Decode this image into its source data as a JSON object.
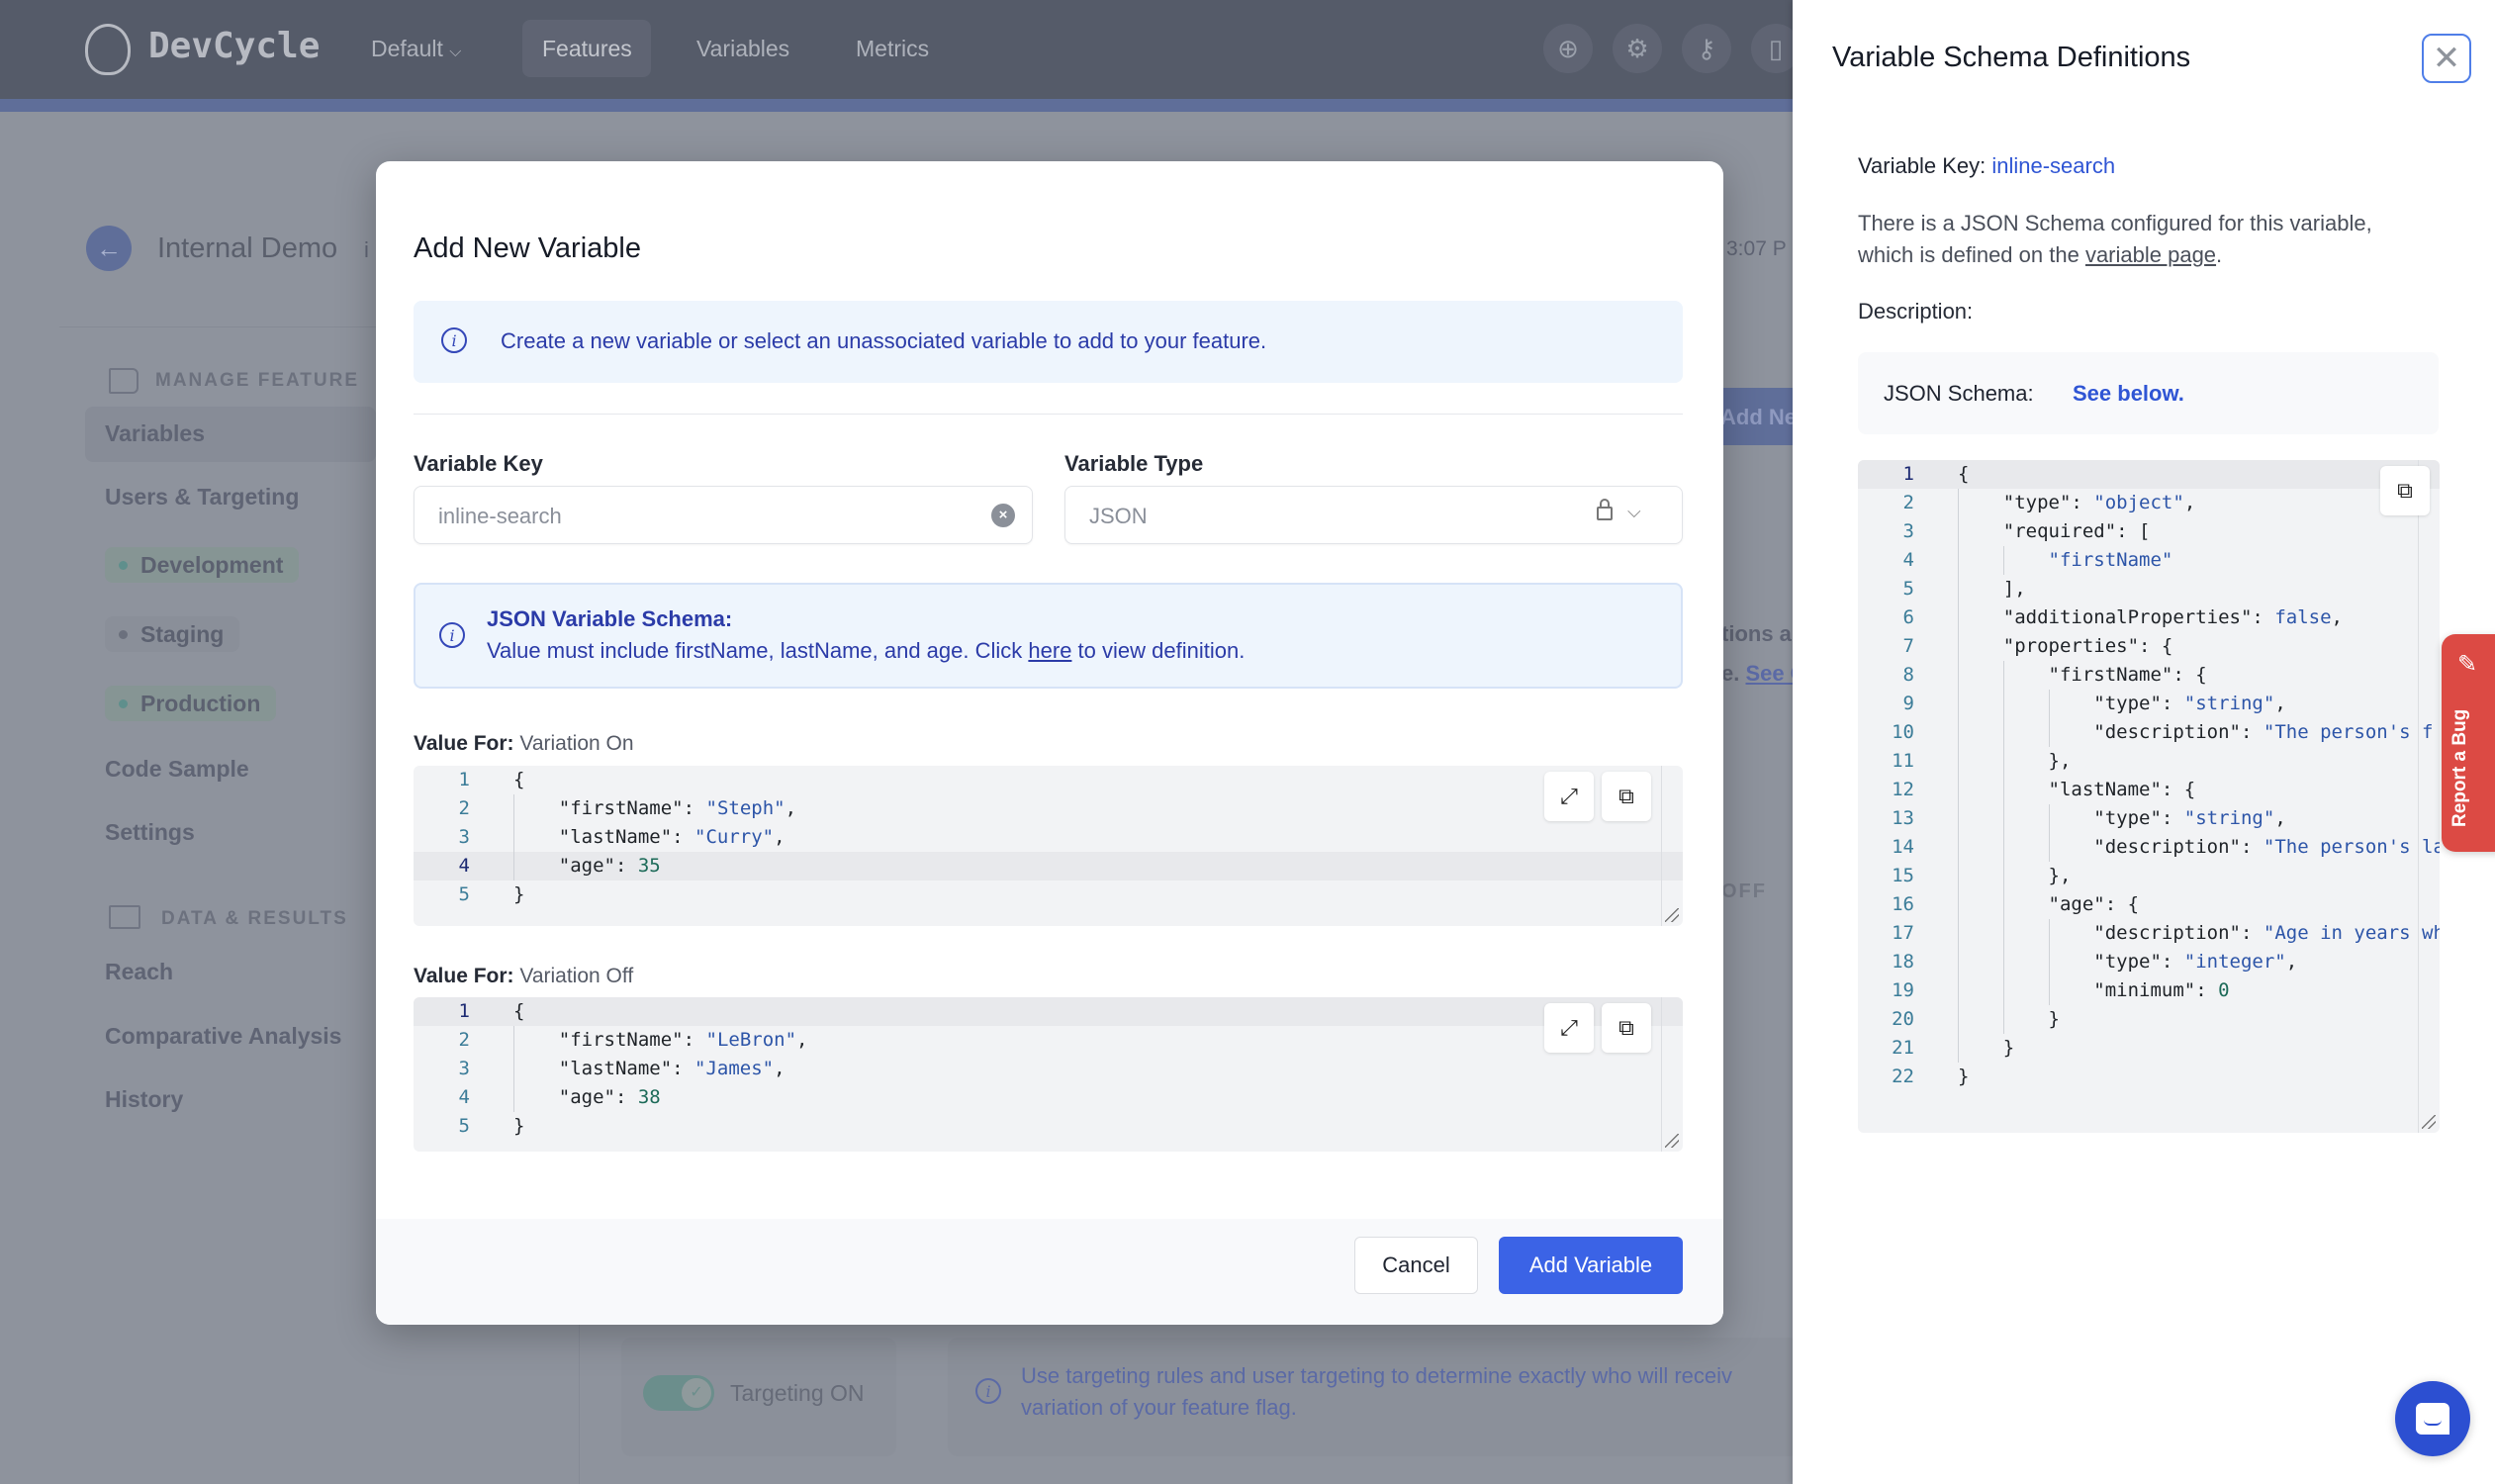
{
  "nav": {
    "logo": "DevCycle",
    "project_selector": "Default",
    "tabs": [
      "Features",
      "Variables",
      "Metrics"
    ],
    "active_tab": "Features",
    "icons": [
      "plus-circle-icon",
      "gear-icon",
      "key-icon",
      "book-icon"
    ]
  },
  "background": {
    "feature_title": "Internal Demo",
    "feature_key_fragment": "i",
    "timestamp_fragment": "3:07 P",
    "add_button_fragment": "Add Ne",
    "text_fragment_1": "tions ar",
    "text_fragment_2": "e.",
    "link_fragment": "See C",
    "off_fragment": "OFF",
    "targeting_toggle_label": "Targeting ON",
    "targeting_info_line1": "Use targeting rules and user targeting to determine exactly who will receiv",
    "targeting_info_line2": "variation of your feature flag."
  },
  "sidebar": {
    "manage_section": "MANAGE FEATURE",
    "items": [
      "Variables",
      "Users & Targeting"
    ],
    "environments": [
      {
        "label": "Development",
        "color": "#5f8f8c"
      },
      {
        "label": "Staging",
        "color": "#6b707d"
      },
      {
        "label": "Production",
        "color": "#5f8f8c"
      }
    ],
    "items2": [
      "Code Sample",
      "Settings"
    ],
    "data_section": "DATA & RESULTS",
    "data_items": [
      "Reach",
      "Comparative Analysis",
      "History"
    ]
  },
  "modal": {
    "title": "Add New Variable",
    "info": "Create a new variable or select an unassociated variable to add to your feature.",
    "variable_key_label": "Variable Key",
    "variable_key_value": "inline-search",
    "variable_type_label": "Variable Type",
    "variable_type_value": "JSON",
    "schema_title": "JSON Variable Schema:",
    "schema_text_before": "Value must include firstName, lastName, and age. Click ",
    "schema_link": "here",
    "schema_text_after": " to view definition.",
    "value_for_label": "Value For:",
    "variations": [
      {
        "name": "Variation On",
        "active_line": 4,
        "lines": [
          "{",
          "    \"firstName\": \"Steph\",",
          "    \"lastName\": \"Curry\",",
          "    \"age\": 35",
          "}"
        ]
      },
      {
        "name": "Variation Off",
        "active_line": 1,
        "lines": [
          "{",
          "    \"firstName\": \"LeBron\",",
          "    \"lastName\": \"James\",",
          "    \"age\": 38",
          "}"
        ]
      }
    ],
    "cancel": "Cancel",
    "submit": "Add Variable"
  },
  "schema_panel": {
    "title": "Variable Schema Definitions",
    "key_label": "Variable Key:",
    "key_value": "inline-search",
    "para_before": "There is a JSON Schema configured for this variable, which is defined on the ",
    "para_link": "variable page",
    "para_after": ".",
    "description_label": "Description:",
    "schema_label": "JSON Schema:",
    "schema_link": "See below.",
    "active_line": 1,
    "lines": [
      "{",
      "    \"type\": \"object\",",
      "    \"required\": [",
      "        \"firstName\"",
      "    ],",
      "    \"additionalProperties\": false,",
      "    \"properties\": {",
      "        \"firstName\": {",
      "            \"type\": \"string\",",
      "            \"description\": \"The person's f",
      "        },",
      "        \"lastName\": {",
      "            \"type\": \"string\",",
      "            \"description\": \"The person's la",
      "        },",
      "        \"age\": {",
      "            \"description\": \"Age in years wh",
      "            \"type\": \"integer\",",
      "            \"minimum\": 0",
      "        }",
      "    }",
      "}"
    ]
  },
  "report_bug": "Report a Bug",
  "colors": {
    "primary": "#3b63e6",
    "info_text": "#2b3ba8",
    "report_bug": "#dc4a44",
    "chat": "#2c4fd1"
  }
}
